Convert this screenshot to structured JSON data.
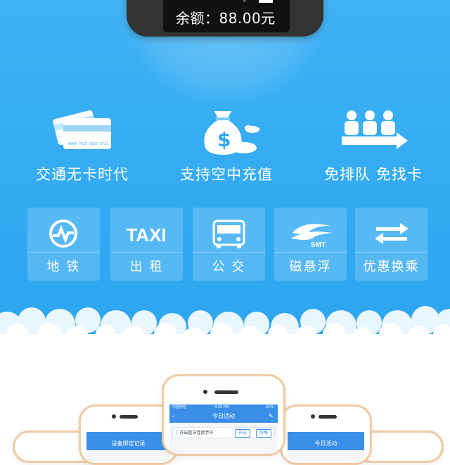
{
  "band": {
    "balance": "余额：88.00元",
    "bluetooth_icon": "bluetooth-icon",
    "battery_icon": "battery-icon"
  },
  "features": [
    {
      "icon": "cards-icon",
      "label": "交通无卡时代"
    },
    {
      "icon": "money-bag-icon",
      "label": "支持空中充值"
    },
    {
      "icon": "queue-people-icon",
      "label": "免排队 免找卡"
    }
  ],
  "tiles": [
    {
      "icon": "metro-icon",
      "label": "地 铁"
    },
    {
      "icon": "taxi-icon",
      "label": "出 租"
    },
    {
      "icon": "bus-icon",
      "label": "公 交"
    },
    {
      "icon": "maglev-icon",
      "label": "磁悬浮"
    },
    {
      "icon": "transfer-icon",
      "label": "优惠换乘"
    }
  ],
  "taxi_text": "TAXI",
  "smt_text": "SMT",
  "card_number": "0000 7639 6653 9722",
  "phones": {
    "center": {
      "carrier": "中国电信",
      "time": "4:42 PM",
      "battery": "22%",
      "title": "今日活动",
      "row": "开启蓝牙连接手环",
      "btn1": "开启",
      "btn2": "忽略"
    },
    "left": {
      "title": "设备绑定记录"
    },
    "right": {
      "title": "今日活动"
    }
  },
  "colors": {
    "sky": "#32aaf2",
    "white": "#ffffff",
    "phone_gold": "#f0c9a2",
    "app_blue": "#3b8fe8"
  }
}
